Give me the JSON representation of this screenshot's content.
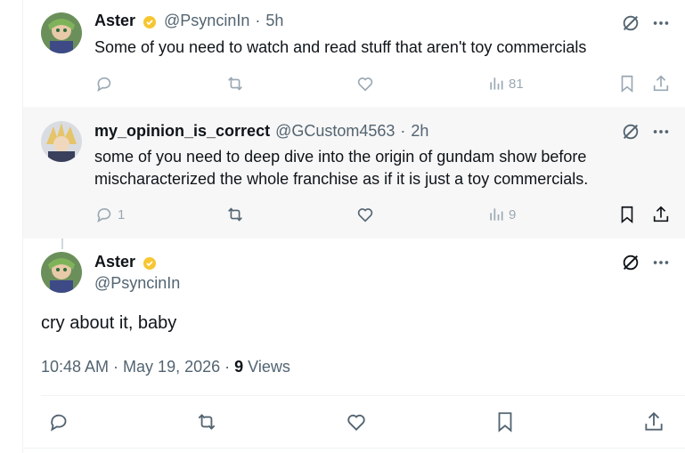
{
  "tweet1": {
    "name": "Aster",
    "handle": "@PsyncinIn",
    "time": "5h",
    "text": "Some of you need to watch and read stuff that aren't toy commercials",
    "views": "81"
  },
  "tweet2": {
    "name": "my_opinion_is_correct",
    "handle": "@GCustom4563",
    "time": "2h",
    "text": "some of you need to deep dive into the origin of gundam show before mischaracterized the whole franchise as if it is just a toy commercials.",
    "replies": "1",
    "views": "9"
  },
  "main": {
    "name": "Aster",
    "handle": "@PsyncinIn",
    "text": "cry about it, baby",
    "timestamp": "10:48 AM · May 19, 2026 · ",
    "views_count": "9",
    "views_label": "Views"
  },
  "separator": "·",
  "colors": {
    "icon": "#536471",
    "text": "#0f1419",
    "line": "#cfd9de",
    "badge": "#f7c631"
  },
  "icons": [
    "grok-icon",
    "more-icon",
    "reply-icon",
    "retweet-icon",
    "like-icon",
    "views-icon",
    "bookmark-icon",
    "share-icon",
    "badge-icon"
  ]
}
